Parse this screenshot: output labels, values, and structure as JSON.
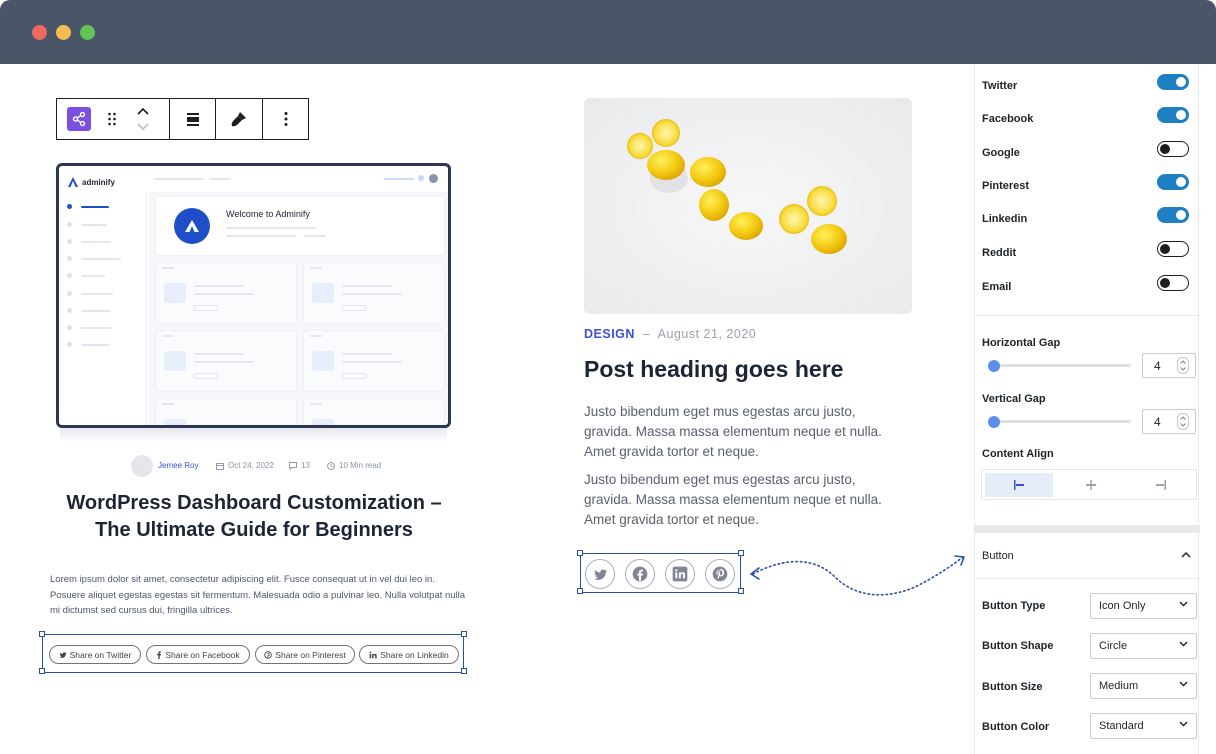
{
  "window": {
    "dots": [
      "#ee6a5f",
      "#f5bd4f",
      "#61c454"
    ]
  },
  "toolbar": {
    "items": [
      "share-icon",
      "drag-handle-icon",
      "move-up-down-icon",
      "align-icon",
      "brush-icon",
      "more-options-icon"
    ]
  },
  "mockup": {
    "brand": "adminify",
    "welcome": "Welcome to Adminify"
  },
  "article": {
    "author": "Jemee Roy",
    "date": "Oct 24, 2022",
    "comments": "13",
    "read_time": "10 Min read",
    "title": "WordPress Dashboard Customization – The Ultimate Guide for Beginners",
    "body": "Lorem ipsum dolor sit amet, consectetur adipiscing elit. Fusce consequat ut in vel dui leo in. Posuere aliquet egestas egestas sit fermentum. Malesuada odio a pulvinar leo. Nulla volutpat nulla mi dictumst sed cursus dui, fringilla ultrices.",
    "share_buttons": [
      "Share on Twitter",
      "Share on Facebook",
      "Share on Pinterest",
      "Share on Linkedin"
    ]
  },
  "post": {
    "category": "DESIGN",
    "separator": "–",
    "date": "August 21, 2020",
    "heading": "Post heading goes here",
    "paragraph1": "Justo bibendum eget mus egestas arcu justo, gravida. Massa massa elementum neque et nulla. Amet gravida tortor et neque.",
    "paragraph2": "Justo bibendum eget mus egestas arcu justo, gravida. Massa massa elementum neque et nulla. Amet gravida tortor et neque.",
    "icons": [
      "twitter-icon",
      "facebook-icon",
      "linkedin-icon",
      "pinterest-icon"
    ]
  },
  "panel": {
    "networks": [
      {
        "label": "Twitter",
        "enabled": true
      },
      {
        "label": "Facebook",
        "enabled": true
      },
      {
        "label": "Google",
        "enabled": false
      },
      {
        "label": "Pinterest",
        "enabled": true
      },
      {
        "label": "Linkedin",
        "enabled": true
      },
      {
        "label": "Reddit",
        "enabled": false
      },
      {
        "label": "Email",
        "enabled": false
      }
    ],
    "horizontal_gap": {
      "label": "Horizontal Gap",
      "value": "4"
    },
    "vertical_gap": {
      "label": "Vertical Gap",
      "value": "4"
    },
    "content_align": {
      "label": "Content Align",
      "options": [
        "align-left-icon",
        "align-center-icon",
        "align-right-icon"
      ],
      "selected": 0
    },
    "button_section": {
      "title": "Button"
    },
    "button_type": {
      "label": "Button Type",
      "value": "Icon Only"
    },
    "button_shape": {
      "label": "Button Shape",
      "value": "Circle"
    },
    "button_size": {
      "label": "Button Size",
      "value": "Medium"
    },
    "button_color": {
      "label": "Button Color",
      "value": "Standard"
    }
  },
  "colors": {
    "accent": "#1e7fc2",
    "link": "#3c50d6",
    "selection": "#2a4fa8"
  }
}
